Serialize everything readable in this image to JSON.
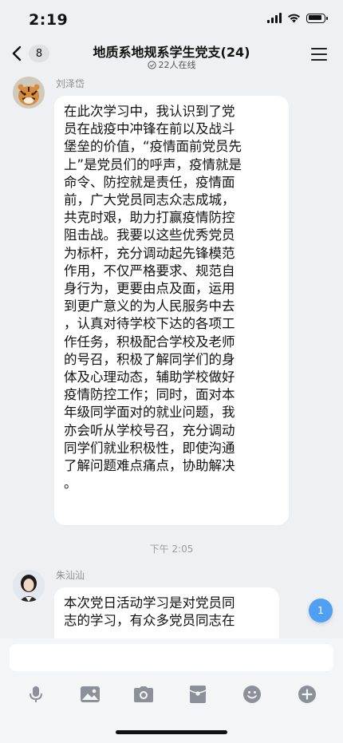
{
  "status": {
    "time": "2:19"
  },
  "header": {
    "back_count": "8",
    "title": "地质系地规系学生党支(24)",
    "online": "22人在线"
  },
  "messages": [
    {
      "sender": "刘泽岱",
      "lines": [
        "在此次学习中，我认识到了党",
        "员在战疫中冲锋在前以及战斗",
        "堡垒的价值，“疫情面前党员先",
        "上”是党员们的呼声，疫情就是",
        "命令、防控就是责任，疫情面",
        "前，广大党员同志众志成城，",
        "共克时艰，助力打赢疫情防控",
        "阻击战。我要以这些优秀党员",
        "为标杆，充分调动起先锋模范",
        "作用，不仅严格要求、规范自",
        "身行为，更要由点及面，运用",
        "到更广意义的为人民服务中去",
        "，认真对待学校下达的各项工",
        "作任务，积极配合学校及老师",
        "的号召，积极了解同学们的身",
        "体及心理动态，辅助学校做好",
        "疫情防控工作；同时，面对本",
        "年级同学面对的就业问题，我",
        "亦会听从学校号召，充分调动",
        "同学们就业积极性，即使沟通",
        "了解问题难点痛点，协助解决",
        "。"
      ]
    },
    {
      "sender": "朱汕汕",
      "lines": [
        "本次党日活动学习是对党员同",
        "志的学习，有众多党员同志在"
      ]
    }
  ],
  "time_divider": "下午 2:05",
  "new_message_badge": "1",
  "input": {
    "placeholder": "",
    "value": ""
  },
  "toolbar_icons": [
    "microphone-icon",
    "image-icon",
    "camera-icon",
    "red-packet-icon",
    "emoji-icon",
    "plus-icon"
  ],
  "colors": {
    "background": "#eef0f4",
    "bubble": "#ffffff",
    "badge": "#4f9ff2"
  }
}
